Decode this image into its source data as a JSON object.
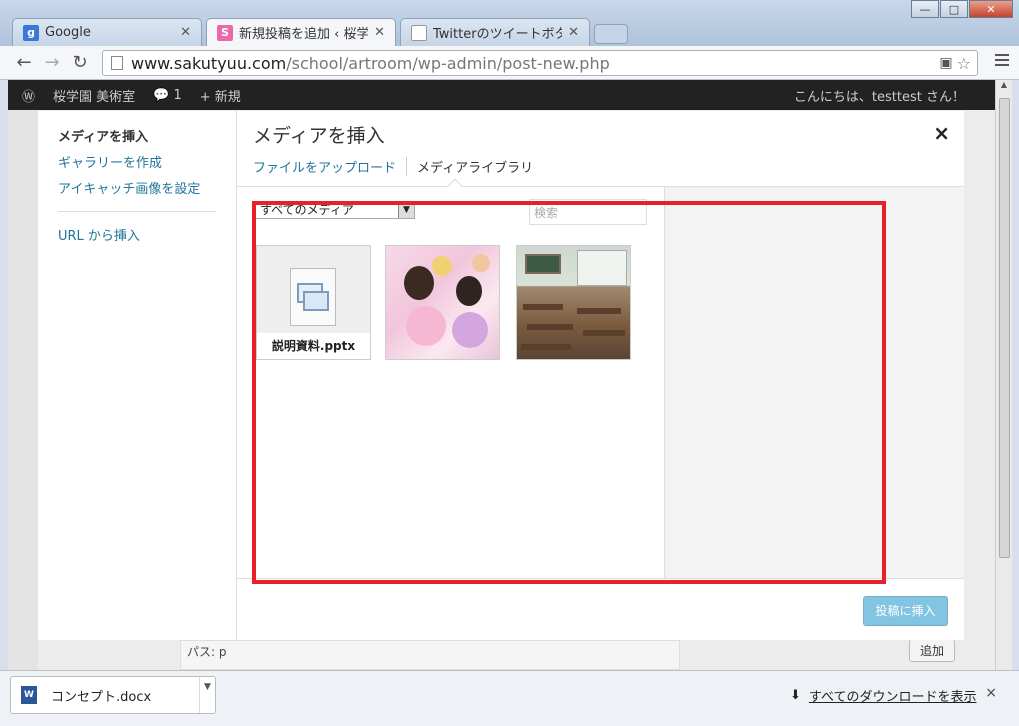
{
  "browser": {
    "tabs": [
      {
        "title": "Google",
        "favicon": "g",
        "favicon_color": "#3a78d8",
        "active": false
      },
      {
        "title": "新規投稿を追加 ‹ 桜学園",
        "favicon": "S",
        "favicon_color": "#e86aa8",
        "active": true
      },
      {
        "title": "Twitterのツイートボタン",
        "favicon": "",
        "favicon_color": "#cccccc",
        "active": false
      }
    ],
    "url_domain": "www.sakutyuu.com",
    "url_path": "/school/artroom/wp-admin/post-new.php",
    "back_icon": "back-arrow-icon",
    "forward_icon": "forward-arrow-icon",
    "reload_icon": "reload-icon"
  },
  "wp": {
    "site_name": "桜学園 美術室",
    "comments_count": "1",
    "new_label": "新規",
    "greeting": "こんにちは、testtest さん！",
    "path_label": "パス: p",
    "add_button": "追加"
  },
  "modal": {
    "sidebar": {
      "items": [
        {
          "label": "メディアを挿入",
          "active": true
        },
        {
          "label": "ギャラリーを作成",
          "active": false
        },
        {
          "label": "アイキャッチ画像を設定",
          "active": false
        }
      ],
      "url_insert": "URL から挿入"
    },
    "title": "メディアを挿入",
    "close": "×",
    "tabs": {
      "upload": "ファイルをアップロード",
      "library": "メディアライブラリ"
    },
    "filter": {
      "selected": "すべてのメディア"
    },
    "search": {
      "placeholder": "検索"
    },
    "attachments": [
      {
        "type": "file",
        "filename": "説明資料.pptx"
      },
      {
        "type": "image"
      },
      {
        "type": "image"
      }
    ],
    "insert_button": "投稿に挿入"
  },
  "downloads": {
    "item": "コンセプト.docx",
    "show_all": "すべてのダウンロードを表示",
    "close": "×"
  },
  "colors": {
    "highlight": "#e8202a",
    "link": "#21759b",
    "primary_button": "#2e9fd2"
  }
}
